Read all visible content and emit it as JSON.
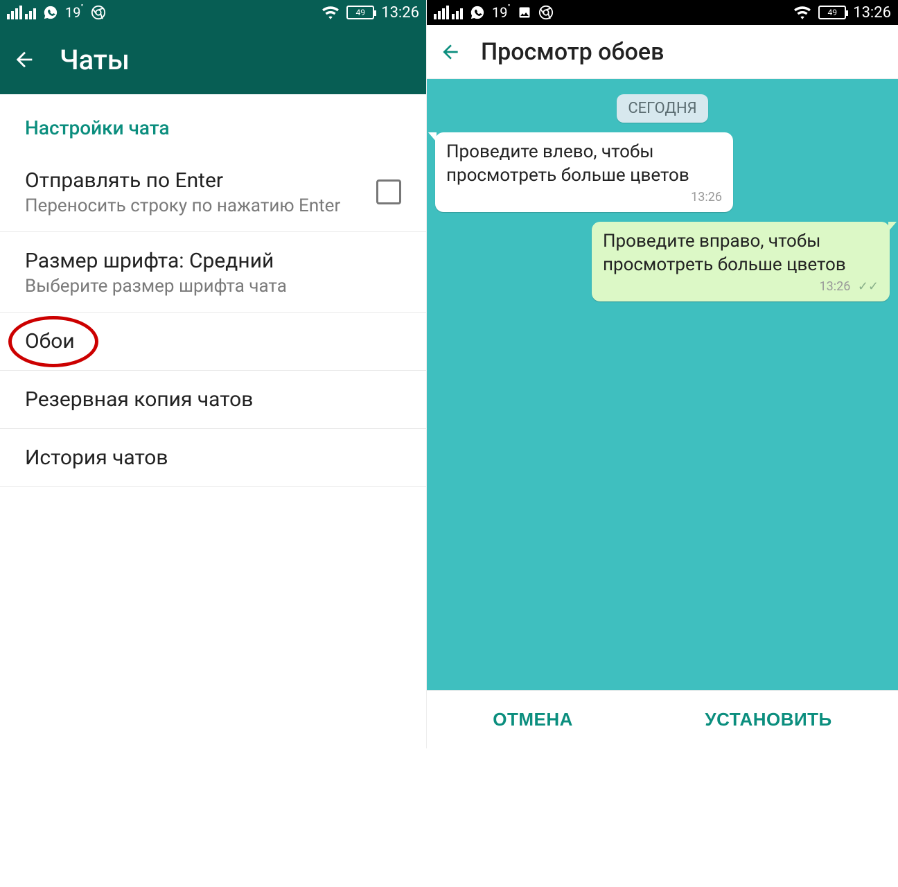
{
  "status": {
    "temp": "19",
    "battery": "49",
    "time": "13:26"
  },
  "left": {
    "toolbar_title": "Чаты",
    "section_header": "Настройки чата",
    "items": {
      "enter": {
        "title": "Отправлять по Enter",
        "sub": "Переносить строку по нажатию Enter"
      },
      "font": {
        "title": "Размер шрифта: Средний",
        "sub": "Выберите размер шрифта чата"
      },
      "wallpaper": {
        "title": "Обои"
      },
      "backup": {
        "title": "Резервная копия чатов"
      },
      "history": {
        "title": "История чатов"
      }
    }
  },
  "right": {
    "title": "Просмотр обоев",
    "date_label": "СЕГОДНЯ",
    "incoming": {
      "text": "Проведите влево, чтобы просмотреть больше цветов",
      "time": "13:26"
    },
    "outgoing": {
      "text": "Проведите вправо, чтобы просмотреть больше цветов",
      "time": "13:26"
    },
    "cancel": "ОТМЕНА",
    "apply": "УСТАНОВИТЬ"
  }
}
